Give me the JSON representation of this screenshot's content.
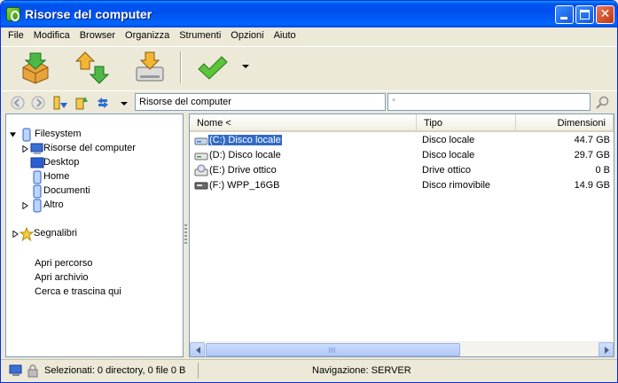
{
  "window": {
    "title": "Risorse del computer"
  },
  "menu": [
    "File",
    "Modifica",
    "Browser",
    "Organizza",
    "Strumenti",
    "Opzioni",
    "Aiuto"
  ],
  "toolbar": {
    "icons": [
      "extract-icon",
      "move-up-down-icon",
      "install-icon",
      "checkmark-icon",
      "dropdown-arrow-icon"
    ]
  },
  "address": {
    "path": "Risorse del computer",
    "filter_placeholder": "*"
  },
  "tree": {
    "root": "Filesystem",
    "children": [
      "Risorse del computer",
      "Desktop",
      "Home",
      "Documenti",
      "Altro"
    ],
    "bookmarks": "Segnalibri"
  },
  "actions": [
    "Apri percorso",
    "Apri archivio",
    "Cerca e trascina qui"
  ],
  "columns": {
    "name": "Nome <",
    "type": "Tipo",
    "size": "Dimensioni"
  },
  "files": [
    {
      "name": "(C:) Disco locale",
      "type": "Disco locale",
      "size": "44.7 GB",
      "icon": "hard-drive-icon",
      "selected": true
    },
    {
      "name": "(D:) Disco locale",
      "type": "Disco locale",
      "size": "29.7 GB",
      "icon": "hard-drive-icon",
      "selected": false
    },
    {
      "name": "(E:) Drive ottico",
      "type": "Drive ottico",
      "size": "0 B",
      "icon": "optical-drive-icon",
      "selected": false
    },
    {
      "name": "(F:) WPP_16GB",
      "type": "Disco rimovibile",
      "size": "14.9 GB",
      "icon": "removable-drive-icon",
      "selected": false
    }
  ],
  "status": {
    "selection": "Selezionati: 0 directory, 0 file 0 B",
    "navigation": "Navigazione: SERVER"
  },
  "colors": {
    "titlebar": "#0054e3",
    "selection": "#316ac5",
    "window_bg": "#ece9d8"
  }
}
